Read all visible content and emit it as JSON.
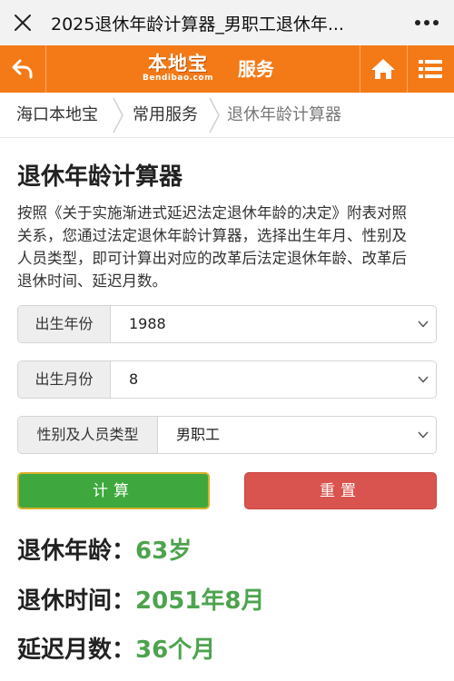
{
  "browser": {
    "title": "2025退休年龄计算器_男职工退休年...",
    "close_icon": "close-icon",
    "more_icon": "more-dots-icon"
  },
  "header": {
    "logo_text": "本地宝",
    "logo_sub": "Bendibao.com",
    "section": "服务",
    "back_icon": "back-arrow-icon",
    "home_icon": "home-icon",
    "menu_icon": "list-menu-icon",
    "color": "#f47a17"
  },
  "breadcrumb": [
    "海口本地宝",
    "常用服务",
    "退休年龄计算器"
  ],
  "page": {
    "title": "退休年龄计算器",
    "description_lines": [
      "按照《关于实施渐进式延迟法定退休年龄的决定》附表对照",
      "关系，您通过法定退休年龄计算器，选择出生年月、性别及",
      "人员类型，即可计算出对应的改革后法定退休年龄、改革后",
      "退休时间、延迟月数。"
    ]
  },
  "form": {
    "birth_year": {
      "label": "出生年份",
      "value": "1988"
    },
    "birth_month": {
      "label": "出生月份",
      "value": "8"
    },
    "type": {
      "label": "性别及人员类型",
      "value": "男职工"
    }
  },
  "buttons": {
    "calc": "计算",
    "reset": "重置",
    "calc_color": "#3ea83e",
    "reset_color": "#d9534f"
  },
  "results": {
    "age_label": "退休年龄：",
    "age_value": "63岁",
    "time_label": "退休时间：",
    "time_value": "2051年8月",
    "delay_label": "延迟月数：",
    "delay_value": "36个月",
    "value_color": "#4ea34e"
  }
}
